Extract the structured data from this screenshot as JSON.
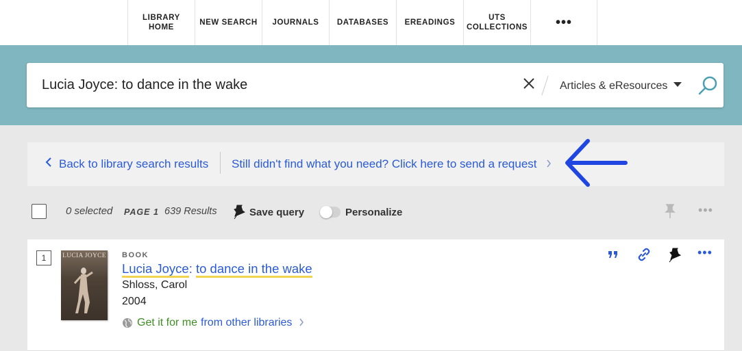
{
  "nav": {
    "items": [
      {
        "label": "LIBRARY\nHOME"
      },
      {
        "label": "NEW SEARCH"
      },
      {
        "label": "JOURNALS"
      },
      {
        "label": "DATABASES"
      },
      {
        "label": "EREADINGS"
      },
      {
        "label": "UTS\nCOLLECTIONS"
      }
    ],
    "more_label": "•••"
  },
  "search": {
    "query": "Lucia Joyce: to dance in the wake",
    "clear_icon": "close-icon",
    "scope": "Articles & eResources",
    "band_color": "#7fb6c0"
  },
  "backbar": {
    "back_label": "Back to library search results",
    "request_label": "Still didn't find what you need? Click here to send a request",
    "annotation_color": "#1f46e0"
  },
  "toolbar": {
    "selected": "0 selected",
    "page": "PAGE 1",
    "results": "639 Results",
    "save_query": "Save query",
    "personalize": "Personalize",
    "personalize_on": false,
    "more": "•••"
  },
  "results": [
    {
      "rank": "1",
      "type": "BOOK",
      "title_part1": "Lucia Joyce",
      "title_sep": ": ",
      "title_part2": "to dance in the wake",
      "author": "Shloss, Carol",
      "year": "2004",
      "cover_title": "LUCIA JOYCE",
      "getit_green": "Get it for me",
      "getit_blue": "from other libraries",
      "more": "•••"
    }
  ],
  "colors": {
    "link": "#2a5ad7",
    "green": "#3f8d25",
    "highlight": "#f0d34f"
  }
}
